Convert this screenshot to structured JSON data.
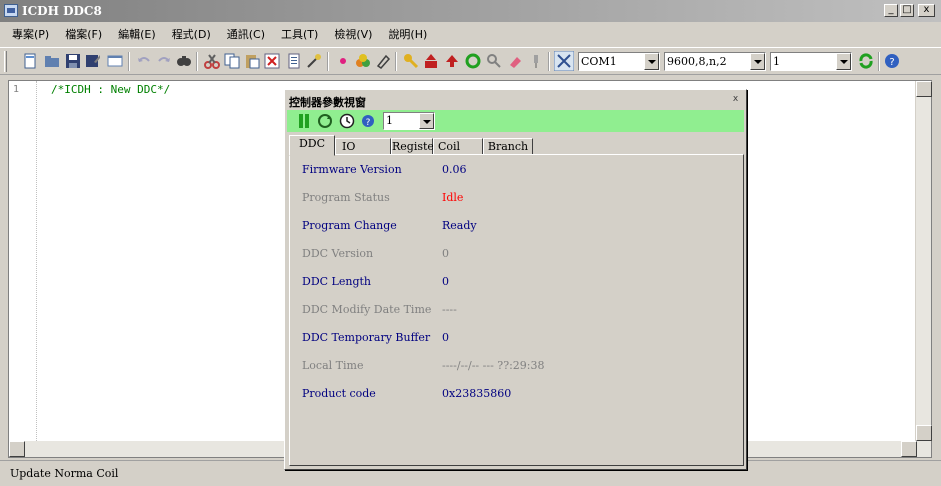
{
  "window": {
    "title": "ICDH DDC8",
    "min": "_",
    "max": "□",
    "close": "x"
  },
  "menu": [
    "專案(P)",
    "檔案(F)",
    "編輯(E)",
    "程式(D)",
    "通訊(C)",
    "工具(T)",
    "檢視(V)",
    "說明(H)"
  ],
  "toolbar": {
    "port": "COM1",
    "baud": "9600,8,n,2",
    "station": "1"
  },
  "editor": {
    "line_number": "1",
    "code": "/*ICDH : New DDC*/"
  },
  "dialog": {
    "title": "控制器參數視窗",
    "close": "x",
    "station_select": "1",
    "tabs": [
      "DDC",
      "IO",
      "Register",
      "Coil",
      "Branch"
    ],
    "rows": [
      {
        "label": "Firmware Version",
        "value": "0.06",
        "label_color": "#000080",
        "value_color": "#000080"
      },
      {
        "label": "Program Status",
        "value": "Idle",
        "label_color": "#808080",
        "value_color": "#ff0000"
      },
      {
        "label": "Program Change",
        "value": "Ready",
        "label_color": "#000080",
        "value_color": "#000080"
      },
      {
        "label": "DDC Version",
        "value": "0",
        "label_color": "#808080",
        "value_color": "#808080"
      },
      {
        "label": "DDC Length",
        "value": "0",
        "label_color": "#000080",
        "value_color": "#000080"
      },
      {
        "label": "DDC Modify Date Time",
        "value": "----",
        "label_color": "#808080",
        "value_color": "#808080"
      },
      {
        "label": "DDC Temporary Buffer",
        "value": "0",
        "label_color": "#000080",
        "value_color": "#000080"
      },
      {
        "label": "Local Time",
        "value": "----/--/-- --- ??:29:38",
        "label_color": "#808080",
        "value_color": "#808080"
      },
      {
        "label": "Product code",
        "value": "0x23835860",
        "label_color": "#000080",
        "value_color": "#000080"
      }
    ]
  },
  "status": {
    "text": "Update Norma Coil"
  },
  "icons": [
    "new-file-icon",
    "open-folder-icon",
    "save-icon",
    "save-as-icon",
    "window-icon",
    "undo-icon",
    "redo-icon",
    "find-icon",
    "cut-icon",
    "copy-icon",
    "paste-icon",
    "delete-icon",
    "print-icon",
    "magic-wand-icon",
    "bullet-icon",
    "group-icon",
    "erase-icon",
    "key-icon",
    "upload-icon",
    "download-icon",
    "refresh-icon",
    "search-icon",
    "clear-icon",
    "pin-icon",
    "connect-icon",
    "refresh-green-icon",
    "help-icon"
  ]
}
